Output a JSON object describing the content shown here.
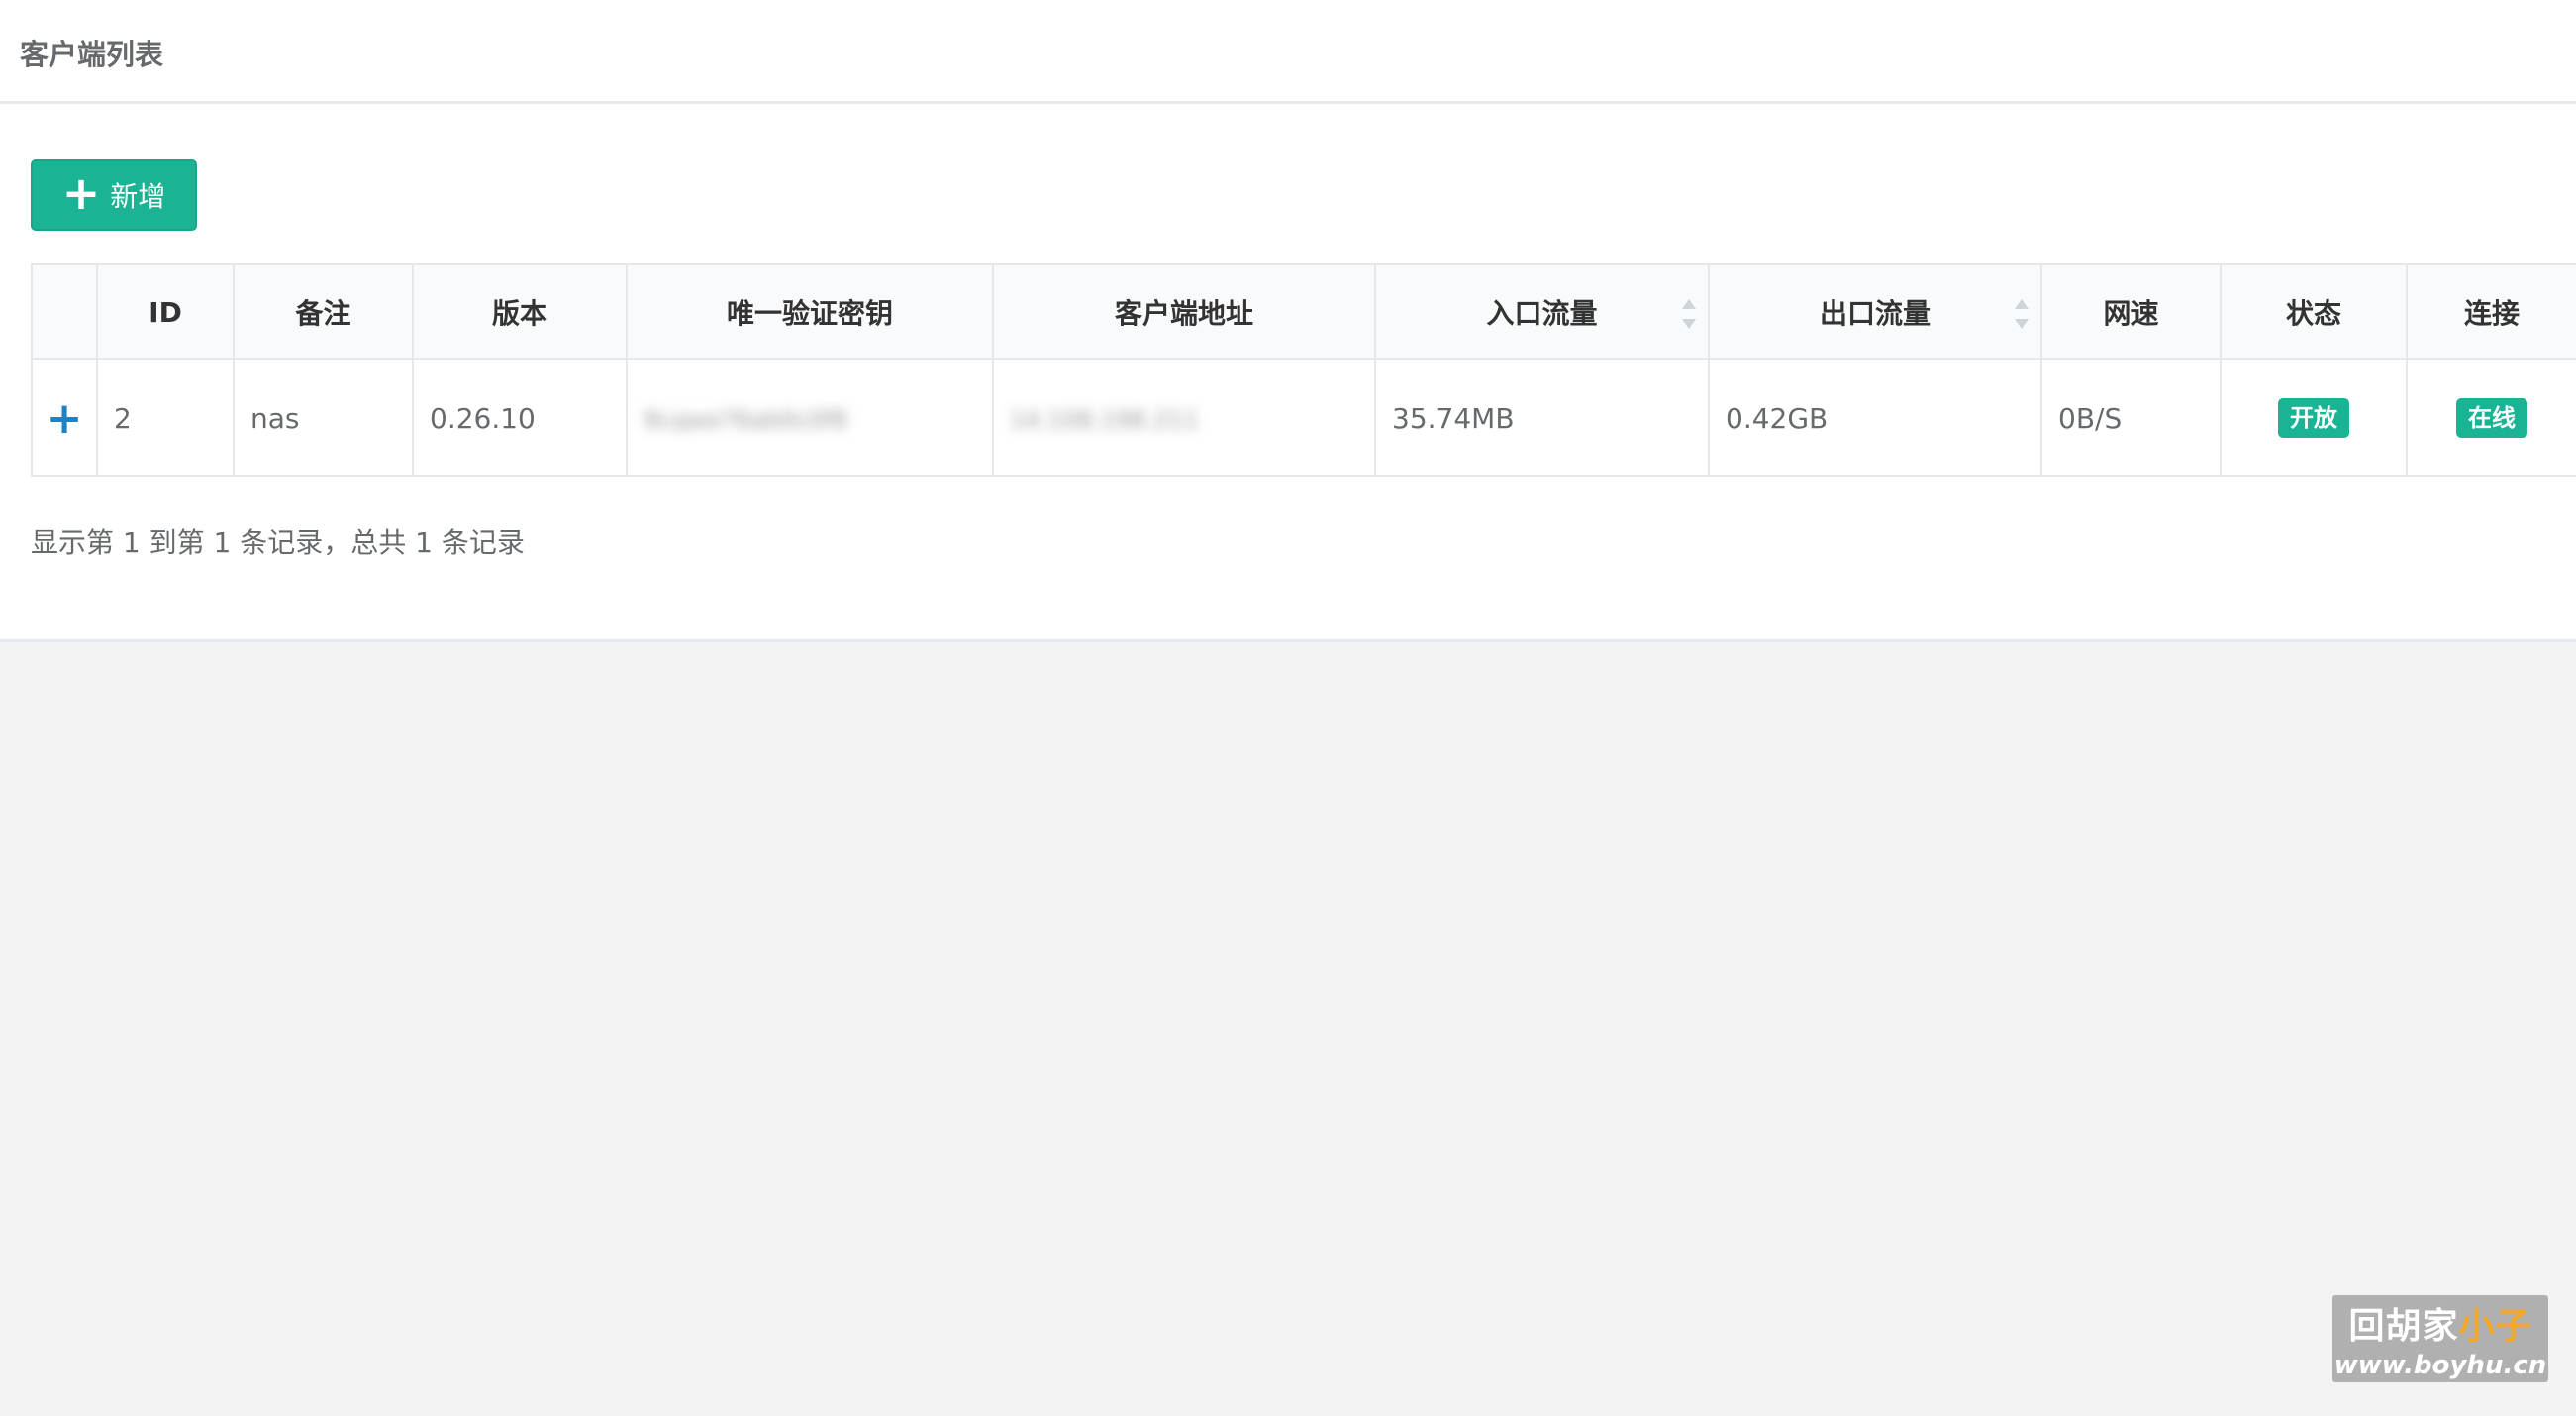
{
  "panel": {
    "title": "客户端列表"
  },
  "toolbar": {
    "add_icon": "plus-icon",
    "add_label": "新增"
  },
  "table": {
    "columns": [
      {
        "label": ""
      },
      {
        "label": "ID"
      },
      {
        "label": "备注"
      },
      {
        "label": "版本"
      },
      {
        "label": "唯一验证密钥"
      },
      {
        "label": "客户端地址"
      },
      {
        "label": "入口流量",
        "sortable": true
      },
      {
        "label": "出口流量",
        "sortable": true
      },
      {
        "label": "网速"
      },
      {
        "label": "状态"
      },
      {
        "label": "连接"
      }
    ],
    "rows": [
      {
        "expand": "+",
        "id": "2",
        "remark": "nas",
        "version": "0.26.10",
        "key_blurred": "9cqwe76ab0c0f8",
        "address_blurred": "14.108.198.211",
        "in_traffic": "35.74MB",
        "out_traffic": "0.42GB",
        "speed": "0B/S",
        "status": "开放",
        "connection": "在线"
      }
    ]
  },
  "footer": {
    "records_info": "显示第 1 到第 1 条记录，总共 1 条记录"
  },
  "watermark": {
    "brand_part1": "回胡家",
    "brand_part2": "小子",
    "url": "www.boyhu.cn"
  },
  "colors": {
    "primary": "#1ab394",
    "expand_icon": "#1c84c6",
    "page_bg": "#f3f3f4"
  }
}
